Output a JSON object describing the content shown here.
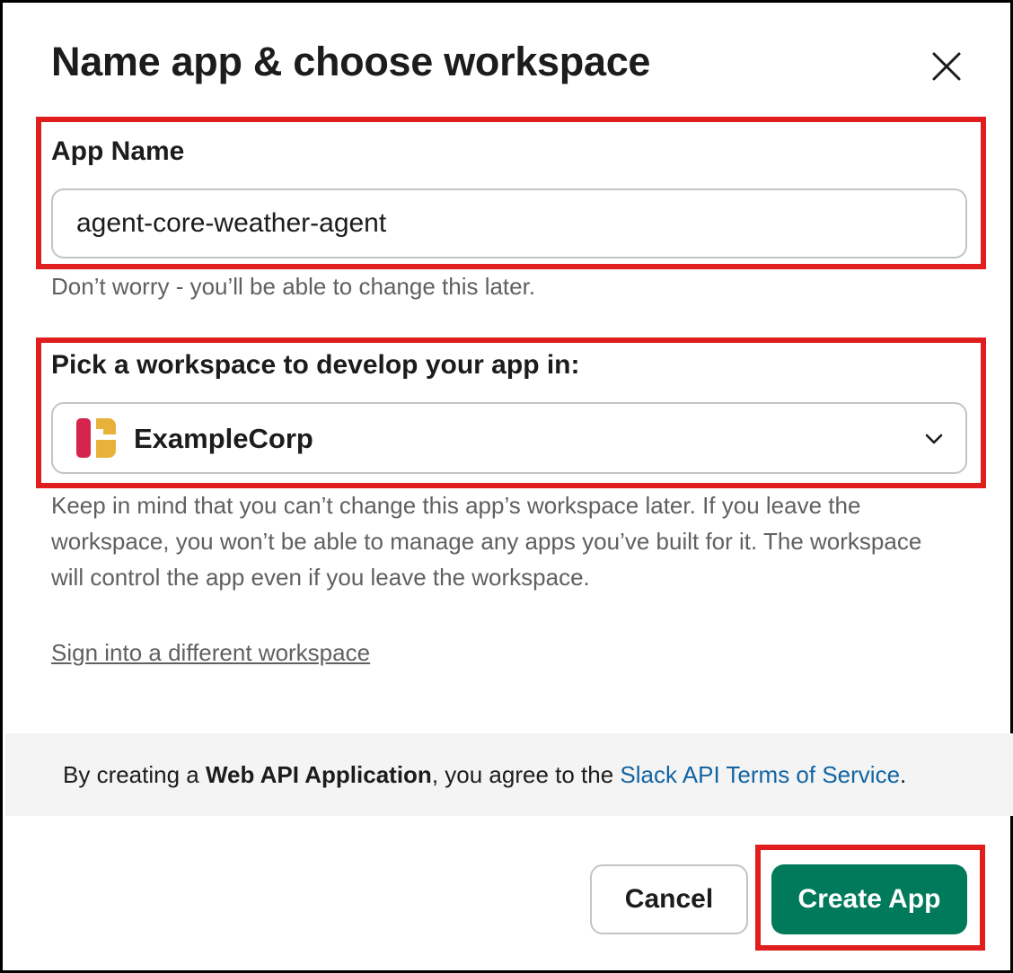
{
  "dialog": {
    "title": "Name app & choose workspace",
    "close_icon": "close-icon"
  },
  "app_name": {
    "label": "App Name",
    "value": "agent-core-weather-agent",
    "hint": "Don’t worry - you’ll be able to change this later."
  },
  "workspace": {
    "label": "Pick a workspace to develop your app in:",
    "selected": "ExampleCorp",
    "logo_icon": "workspace-logo-icon",
    "logo_colors": [
      "#d5254f",
      "#e8b13a"
    ],
    "dropdown_icon": "chevron-down-icon",
    "hint": "Keep in mind that you can’t change this app’s workspace later. If you leave the workspace, you won’t be able to manage any apps you’ve built for it. The workspace will control the app even if you leave the workspace.",
    "switch_link": "Sign into a different workspace"
  },
  "terms": {
    "prefix": "By creating a ",
    "app_type": "Web API Application",
    "middle": ", you agree to the ",
    "link_text": "Slack API Terms of Service",
    "suffix": "."
  },
  "actions": {
    "cancel_label": "Cancel",
    "create_label": "Create App"
  },
  "colors": {
    "highlight": "#e01e1e",
    "primary_button": "#007a5a",
    "link": "#1264a3",
    "hint_text": "#616061"
  }
}
